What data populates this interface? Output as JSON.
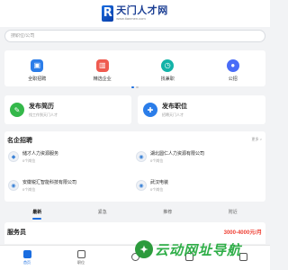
{
  "header": {
    "logo_letter": "R",
    "logo_title": "天门人才网",
    "logo_sub": "www.tianmen.com"
  },
  "search": {
    "placeholder": "搜职位/公司"
  },
  "categories": [
    {
      "label": "全职招聘",
      "color": "#2b7de9",
      "icon": "briefcase-icon"
    },
    {
      "label": "精选企业",
      "color": "#ef5a4f",
      "icon": "building-icon"
    },
    {
      "label": "找兼职",
      "color": "#12b3a8",
      "icon": "clock-icon"
    },
    {
      "label": "公招",
      "color": "#4a6cf7",
      "icon": "person-icon"
    }
  ],
  "quick_actions": [
    {
      "title": "发布简历",
      "desc": "找工作到天门人才",
      "color": "#34b84a",
      "icon": "resume-icon"
    },
    {
      "title": "发布职位",
      "desc": "招聘天门人才",
      "color": "#2b7de9",
      "icon": "post-job-icon"
    }
  ],
  "companies": {
    "title": "名企招聘",
    "more": "更多 >",
    "items": [
      {
        "name": "储才人力资源服务",
        "jobs": "0个岗位"
      },
      {
        "name": "湖北圆仁人力资源有限公司",
        "jobs": "0个岗位"
      },
      {
        "name": "安徽锐汇智能科技有限公司",
        "jobs": "0个岗位"
      },
      {
        "name": "武汉电装",
        "jobs": "0个岗位"
      }
    ]
  },
  "tabs": [
    "最新",
    "紧急",
    "推荐",
    "附近"
  ],
  "job": {
    "title": "服务员",
    "salary": "3000-4000元/月"
  },
  "watermark": {
    "text": "云动网址导航"
  },
  "tabbar": [
    "首页",
    "职位",
    "",
    "",
    ""
  ]
}
